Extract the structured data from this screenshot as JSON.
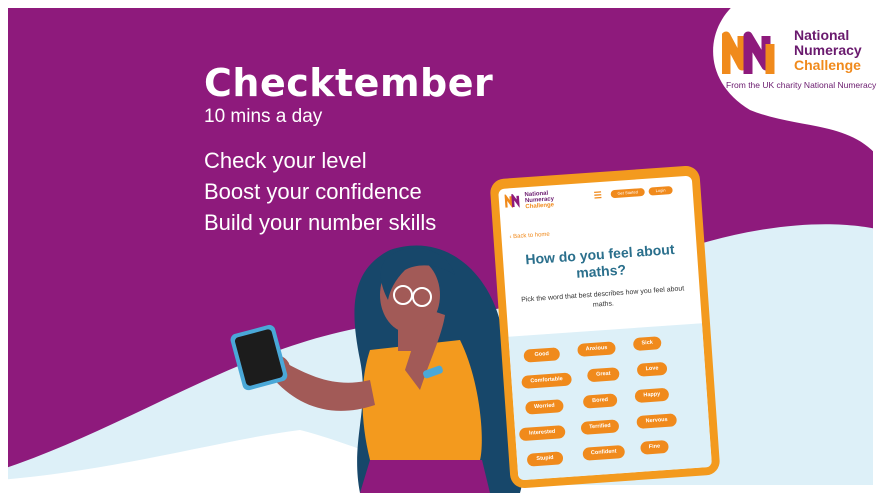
{
  "banner": {
    "title": "Checktember",
    "subtitle": "10 mins a day",
    "bullets": [
      "Check your level",
      "Boost your confidence",
      "Build your number skills"
    ]
  },
  "logo": {
    "line1": "National",
    "line2": "Numeracy",
    "line3": "Challenge",
    "tagline": "From the UK charity National Numeracy"
  },
  "tablet": {
    "logo_line1": "National",
    "logo_line2": "Numeracy",
    "logo_line3": "Challenge",
    "get_started": "Get Started",
    "login": "Login",
    "back": "‹ Back to home",
    "question": "How do you feel about maths?",
    "instruction": "Pick the word that best describes how you feel about maths.",
    "options": [
      "Good",
      "Anxious",
      "Sick",
      "Comfortable",
      "Great",
      "Love",
      "Worried",
      "Bored",
      "Happy",
      "Interested",
      "Terrified",
      "Nervous",
      "Stupid",
      "Confident",
      "Fine"
    ]
  },
  "colors": {
    "purple": "#8e1a7c",
    "orange": "#f39a1e",
    "light_blue": "#ddf0f8",
    "logo_purple": "#6a1a6e"
  },
  "icons": [
    "menu-icon",
    "phone-icon",
    "glasses-icon",
    "wristband-icon"
  ]
}
